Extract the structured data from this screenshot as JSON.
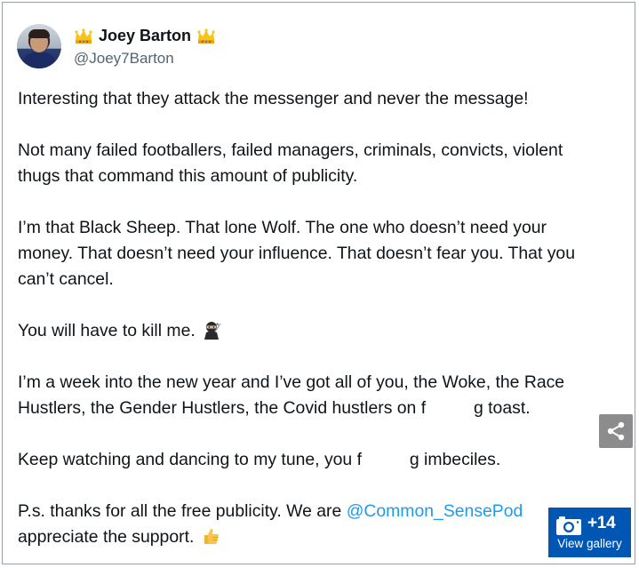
{
  "tweet": {
    "author_name": "Joey Barton",
    "handle": "@Joey7Barton",
    "paragraphs": {
      "p1": "Interesting that they attack the messenger and never the message!",
      "p2": "Not many failed footballers, failed managers, criminals, convicts, violent\nthugs that command this amount of publicity.",
      "p3": "I’m that Black Sheep. That lone Wolf. The one who doesn’t need your\nmoney. That doesn’t need your influence. That doesn’t fear you. That you\ncan’t cancel.",
      "p4": "You will have to kill me.",
      "p5": "I’m a week into the new year and I’ve got all of you, the Woke, the Race\nHustlers, the Gender Hustlers, the Covid hustlers on f          g toast.",
      "p6": "Keep watching and dancing to my tune, you f          g imbeciles.",
      "p7_before": "P.s. thanks for all the free publicity. We are ",
      "p7_mention": "@Common_SensePod",
      "p7_after": "\nappreciate the support."
    },
    "icons": {
      "name_left": "crown-icon",
      "name_right": "crown-icon",
      "p4_emoji": "ninja-icon",
      "p7_emoji": "thumbs-up-icon"
    },
    "colors": {
      "mention": "#1d9bf0",
      "handle": "#536471",
      "gallery_bg": "#0056b3",
      "share_bg": "#8c8c8c"
    }
  },
  "overlay": {
    "share_icon": "share-icon",
    "gallery_count": "+14",
    "gallery_label": "View gallery",
    "gallery_icon": "camera-icon"
  }
}
